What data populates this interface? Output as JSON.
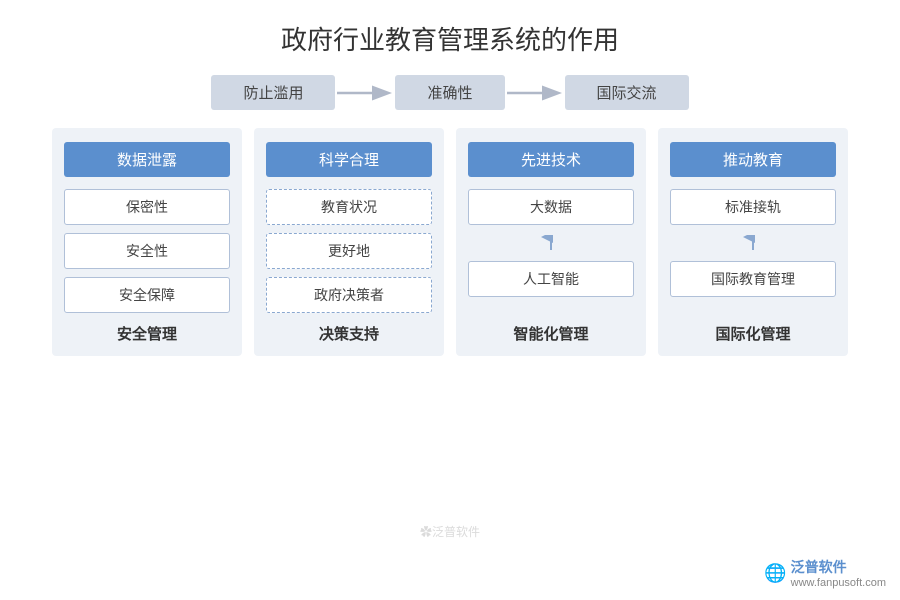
{
  "title": "政府行业教育管理系统的作用",
  "flow": {
    "labels": [
      "防止滥用",
      "准确性",
      "国际交流"
    ]
  },
  "columns": [
    {
      "id": "col1",
      "header": "数据泄露",
      "items": [
        {
          "text": "保密性",
          "style": "solid"
        },
        {
          "text": "安全性",
          "style": "solid"
        },
        {
          "text": "安全保障",
          "style": "solid"
        }
      ],
      "footer": "安全管理",
      "arrows": false
    },
    {
      "id": "col2",
      "header": "科学合理",
      "items": [
        {
          "text": "教育状况",
          "style": "dashed"
        },
        {
          "text": "更好地",
          "style": "dashed"
        },
        {
          "text": "政府决策者",
          "style": "dashed"
        }
      ],
      "footer": "决策支持",
      "arrows": false
    },
    {
      "id": "col3",
      "header": "先进技术",
      "items": [
        {
          "text": "大数据",
          "style": "solid"
        },
        {
          "text": "人工智能",
          "style": "solid"
        }
      ],
      "footer": "智能化管理",
      "arrows": true
    },
    {
      "id": "col4",
      "header": "推动教育",
      "items": [
        {
          "text": "标准接轨",
          "style": "solid"
        },
        {
          "text": "国际教育管理",
          "style": "solid"
        }
      ],
      "footer": "国际化管理",
      "arrows": true
    }
  ],
  "watermark": {
    "logo": "🌐",
    "main": "泛普软件",
    "sub": "www.fanpusoft.com"
  },
  "center_watermark": "✿泛普软件"
}
